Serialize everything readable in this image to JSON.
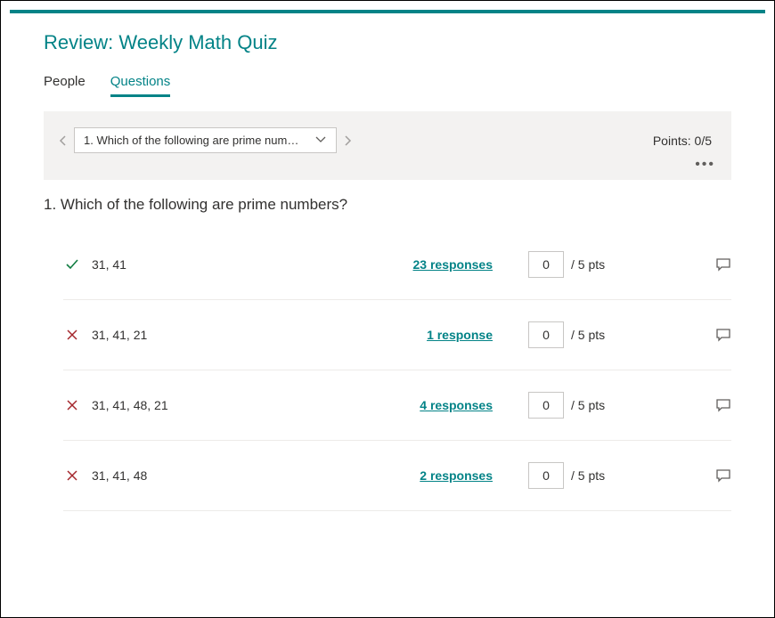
{
  "title": "Review: Weekly Math Quiz",
  "tabs": {
    "people": "People",
    "questions": "Questions"
  },
  "toolbar": {
    "question_selector": "1. Which of the following are prime num…",
    "points_label": "Points: 0/5"
  },
  "question": {
    "title": "1. Which of the following are prime numbers?",
    "pts_suffix": "/ 5 pts",
    "answers": [
      {
        "correct": true,
        "text": "31, 41",
        "responses": "23 responses",
        "pts": "0"
      },
      {
        "correct": false,
        "text": "31, 41, 21",
        "responses": "1 response",
        "pts": "0"
      },
      {
        "correct": false,
        "text": "31, 41, 48, 21",
        "responses": "4 responses",
        "pts": "0"
      },
      {
        "correct": false,
        "text": "31, 41, 48",
        "responses": "2 responses",
        "pts": "0"
      }
    ]
  }
}
